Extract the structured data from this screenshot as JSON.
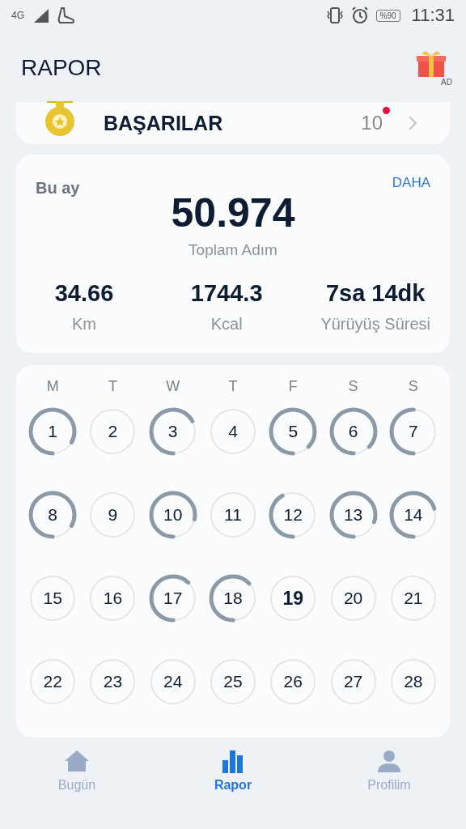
{
  "status_bar": {
    "network": "4G",
    "battery": "%90",
    "time": "11:31"
  },
  "header": {
    "title": "RAPOR",
    "gift_badge": "AD"
  },
  "achievements": {
    "title": "BAŞARILAR",
    "count": "10",
    "new": true
  },
  "summary": {
    "period": "Bu ay",
    "more": "DAHA",
    "total": "50.974",
    "total_label": "Toplam Adım",
    "stats": [
      {
        "value": "34.66",
        "label": "Km"
      },
      {
        "value": "1744.3",
        "label": "Kcal"
      },
      {
        "value": "7sa 14dk",
        "label": "Yürüyüş Süresi"
      }
    ]
  },
  "calendar": {
    "weekdays": [
      "M",
      "T",
      "W",
      "T",
      "F",
      "S",
      "S"
    ],
    "days": [
      {
        "day": "1",
        "today": false
      },
      {
        "day": "2",
        "today": false
      },
      {
        "day": "3",
        "today": false
      },
      {
        "day": "4",
        "today": false
      },
      {
        "day": "5",
        "today": false
      },
      {
        "day": "6",
        "today": false
      },
      {
        "day": "7",
        "today": false
      },
      {
        "day": "8",
        "today": false
      },
      {
        "day": "9",
        "today": false
      },
      {
        "day": "10",
        "today": false
      },
      {
        "day": "11",
        "today": false
      },
      {
        "day": "12",
        "today": false
      },
      {
        "day": "13",
        "today": false
      },
      {
        "day": "14",
        "today": false
      },
      {
        "day": "15",
        "today": false
      },
      {
        "day": "16",
        "today": false
      },
      {
        "day": "17",
        "today": false
      },
      {
        "day": "18",
        "today": false
      },
      {
        "day": "19",
        "today": true
      },
      {
        "day": "20",
        "today": false
      },
      {
        "day": "21",
        "today": false
      },
      {
        "day": "22",
        "today": false
      },
      {
        "day": "23",
        "today": false
      },
      {
        "day": "24",
        "today": false
      },
      {
        "day": "25",
        "today": false
      },
      {
        "day": "26",
        "today": false
      },
      {
        "day": "27",
        "today": false
      },
      {
        "day": "28",
        "today": false
      }
    ]
  },
  "nav": [
    {
      "label": "Bugün",
      "kind": "home",
      "selected": false
    },
    {
      "label": "Rapor",
      "kind": "report",
      "selected": true
    },
    {
      "label": "Profilim",
      "kind": "profile",
      "selected": false
    }
  ]
}
